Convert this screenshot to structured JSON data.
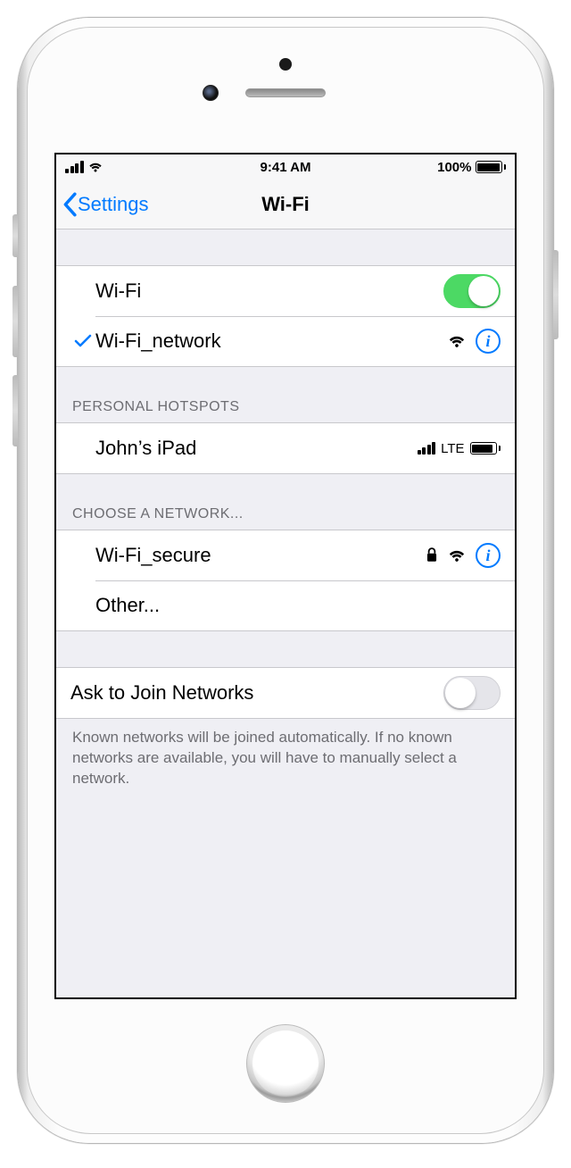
{
  "statusBar": {
    "time": "9:41 AM",
    "batteryPercent": "100%",
    "batteryFill": 100
  },
  "nav": {
    "back": "Settings",
    "title": "Wi-Fi"
  },
  "wifi": {
    "label": "Wi-Fi",
    "on": true,
    "connected": {
      "name": "Wi-Fi_network",
      "secure": false
    }
  },
  "personalHotspots": {
    "header": "PERSONAL HOTSPOTS",
    "items": [
      {
        "name": "John’s iPad",
        "network": "LTE"
      }
    ]
  },
  "chooseNetwork": {
    "header": "CHOOSE A NETWORK...",
    "items": [
      {
        "name": "Wi-Fi_secure",
        "secure": true
      }
    ],
    "other": "Other..."
  },
  "askToJoin": {
    "label": "Ask to Join Networks",
    "on": false,
    "footer": "Known networks will be joined automatically. If no known networks are available, you will have to manually select a network."
  }
}
